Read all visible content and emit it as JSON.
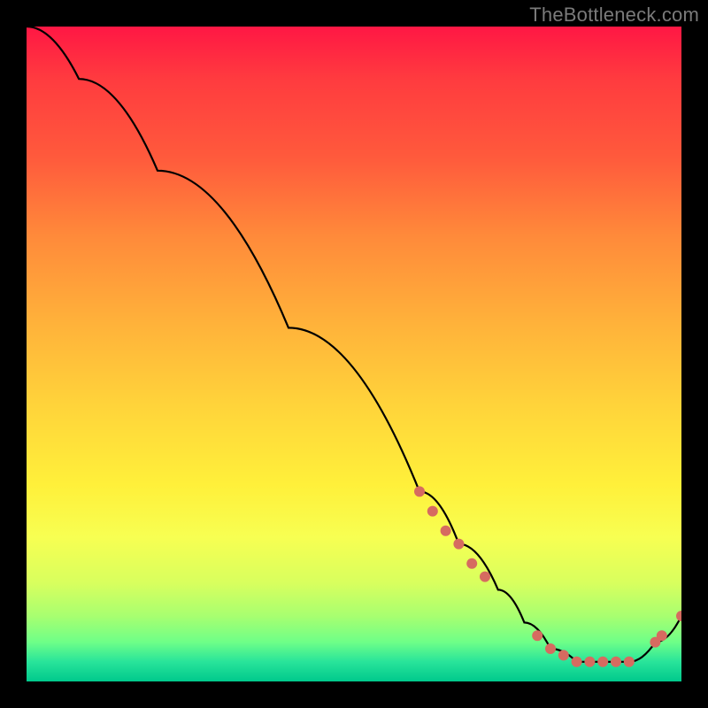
{
  "watermark": "TheBottleneck.com",
  "colors": {
    "line": "#000000",
    "marker": "#d66b60",
    "gradient_top": "#ff1744",
    "gradient_bottom": "#00c98c"
  },
  "chart_data": {
    "type": "line",
    "title": "",
    "xlabel": "",
    "ylabel": "",
    "xlim": [
      0,
      100
    ],
    "ylim": [
      0,
      100
    ],
    "x": [
      0,
      8,
      20,
      40,
      60,
      66,
      72,
      76,
      80,
      84,
      88,
      92,
      96,
      100
    ],
    "y": [
      100,
      92,
      78,
      54,
      29,
      21,
      14,
      9,
      5,
      3,
      3,
      3,
      6,
      10
    ],
    "markers": [
      {
        "x": 60,
        "y": 29
      },
      {
        "x": 62,
        "y": 26
      },
      {
        "x": 64,
        "y": 23
      },
      {
        "x": 66,
        "y": 21
      },
      {
        "x": 68,
        "y": 18
      },
      {
        "x": 70,
        "y": 16
      },
      {
        "x": 78,
        "y": 7
      },
      {
        "x": 80,
        "y": 5
      },
      {
        "x": 82,
        "y": 4
      },
      {
        "x": 84,
        "y": 3
      },
      {
        "x": 86,
        "y": 3
      },
      {
        "x": 88,
        "y": 3
      },
      {
        "x": 90,
        "y": 3
      },
      {
        "x": 92,
        "y": 3
      },
      {
        "x": 96,
        "y": 6
      },
      {
        "x": 97,
        "y": 7
      },
      {
        "x": 100,
        "y": 10
      }
    ]
  }
}
